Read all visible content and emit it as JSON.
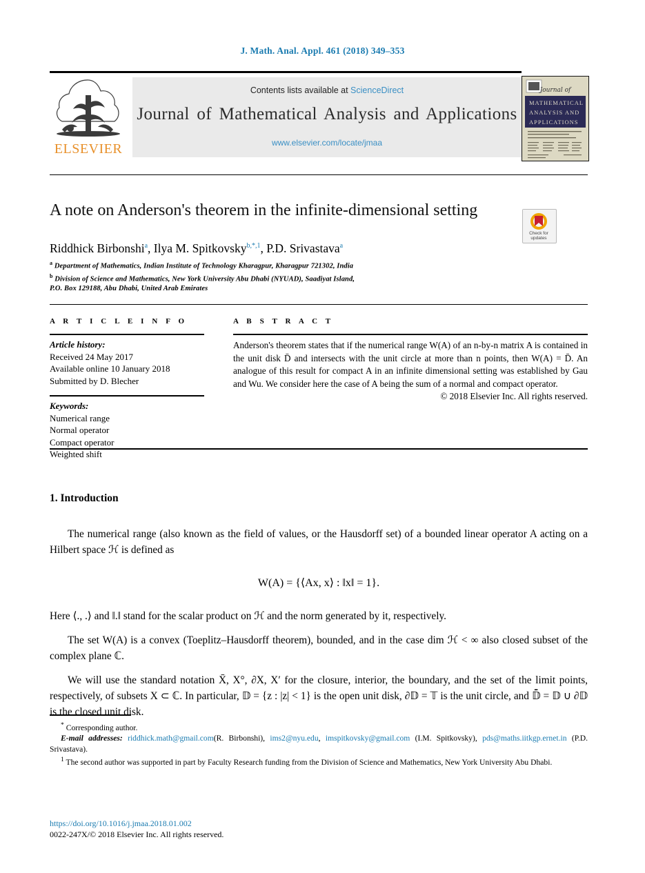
{
  "running_head": "J. Math. Anal. Appl. 461 (2018) 349–353",
  "masthead": {
    "contents_prefix": "Contents lists available at ",
    "contents_link": "ScienceDirect",
    "journal_title": "Journal of Mathematical  Analysis  and  Applications",
    "journal_url": "www.elsevier.com/locate/jmaa",
    "publisher_logo_text": "ELSEVIER",
    "cover_lines": [
      "Journal of",
      "MATHEMATICAL",
      "ANALYSIS AND",
      "APPLICATIONS"
    ]
  },
  "badge": {
    "line1": "Check for",
    "line2": "updates",
    "name": "crossmark-badge"
  },
  "article": {
    "title": "A note on Anderson's theorem in the infinite-dimensional setting",
    "authors_html": "Riddhick Birbonshi<sup>a</sup>, Ilya M. Spitkovsky<sup>b,*,1</sup>, P.D. Srivastava<sup>a</sup>",
    "affiliations": [
      {
        "marker": "a",
        "text": "Department of Mathematics, Indian Institute of Technology Kharagpur, Kharagpur 721302, India"
      },
      {
        "marker": "b",
        "text": "Division of Science and Mathematics, New York University Abu Dhabi (NYUAD), Saadiyat Island,"
      },
      {
        "marker": "",
        "text": "P.O. Box 129188, Abu Dhabi, United Arab Emirates"
      }
    ]
  },
  "info": {
    "heading": "A R T I C L E   I N F O",
    "history_label": "Article history:",
    "history": [
      "Received 24 May 2017",
      "Available online 10 January 2018",
      "Submitted by D. Blecher"
    ],
    "keywords_label": "Keywords:",
    "keywords": [
      "Numerical range",
      "Normal operator",
      "Compact operator",
      "Weighted shift"
    ]
  },
  "abstract": {
    "heading": "A B S T R A C T",
    "text": "Anderson's theorem states that if the numerical range W(A) of an n-by-n matrix A is contained in the unit disk D̄ and intersects with the unit circle at more than n points, then W(A) = D̄. An analogue of this result for compact A in an infinite dimensional setting was established by Gau and Wu. We consider here the case of A being the sum of a normal and compact operator.",
    "copyright": "© 2018 Elsevier Inc. All rights reserved."
  },
  "body": {
    "section_number_title": "1. Introduction",
    "paragraph_1": "The numerical range (also known as the field of values, or the Hausdorff set) of a bounded linear operator A acting on a Hilbert space ℋ is defined as",
    "equation": "W(A) = {⟨Ax, x⟩ : ‖x‖ = 1}.",
    "paragraph_2": "Here ⟨., .⟩ and ‖.‖ stand for the scalar product on ℋ and the norm generated by it, respectively.",
    "paragraph_3": "The set W(A) is a convex (Toeplitz–Hausdorff theorem), bounded, and in the case dim ℋ < ∞ also closed subset of the complex plane ℂ.",
    "paragraph_4": "We will use the standard notation X̄, X°, ∂X, X′ for the closure, interior, the boundary, and the set of the limit points, respectively, of subsets X ⊂ ℂ. In particular, 𝔻 = {z : |z| < 1} is the open unit disk, ∂𝔻 = 𝕋 is the unit circle, and 𝔻̄ = 𝔻 ∪ ∂𝔻 is the closed unit disk."
  },
  "footnotes": {
    "corresponding": "Corresponding author.",
    "corresponding_marker": "*",
    "email_label": "E-mail addresses:",
    "emails": [
      {
        "address": "riddhick.math@gmail.com",
        "owner": "(R. Birbonshi),"
      },
      {
        "address": "ims2@nyu.edu",
        "owner": ","
      },
      {
        "address": "imspitkovsky@gmail.com",
        "owner": "(I.M. Spitkovsky),"
      },
      {
        "address": "pds@maths.iitkgp.ernet.in",
        "owner": "(P.D. Srivastava)."
      }
    ],
    "note_marker": "1",
    "note_text": "The second author was supported in part by Faculty Research funding from the Division of Science and Mathematics, New York University Abu Dhabi."
  },
  "doi": {
    "url": "https://doi.org/10.1016/j.jmaa.2018.01.002",
    "issn_line": "0022-247X/© 2018 Elsevier Inc. All rights reserved."
  },
  "colors": {
    "link_blue": "#1a7bb0",
    "sciencedirect_blue": "#3a8fc4",
    "elsevier_orange": "#E8902A",
    "masthead_grey": "#eaeaea",
    "cover_navy": "#2b2a55"
  }
}
